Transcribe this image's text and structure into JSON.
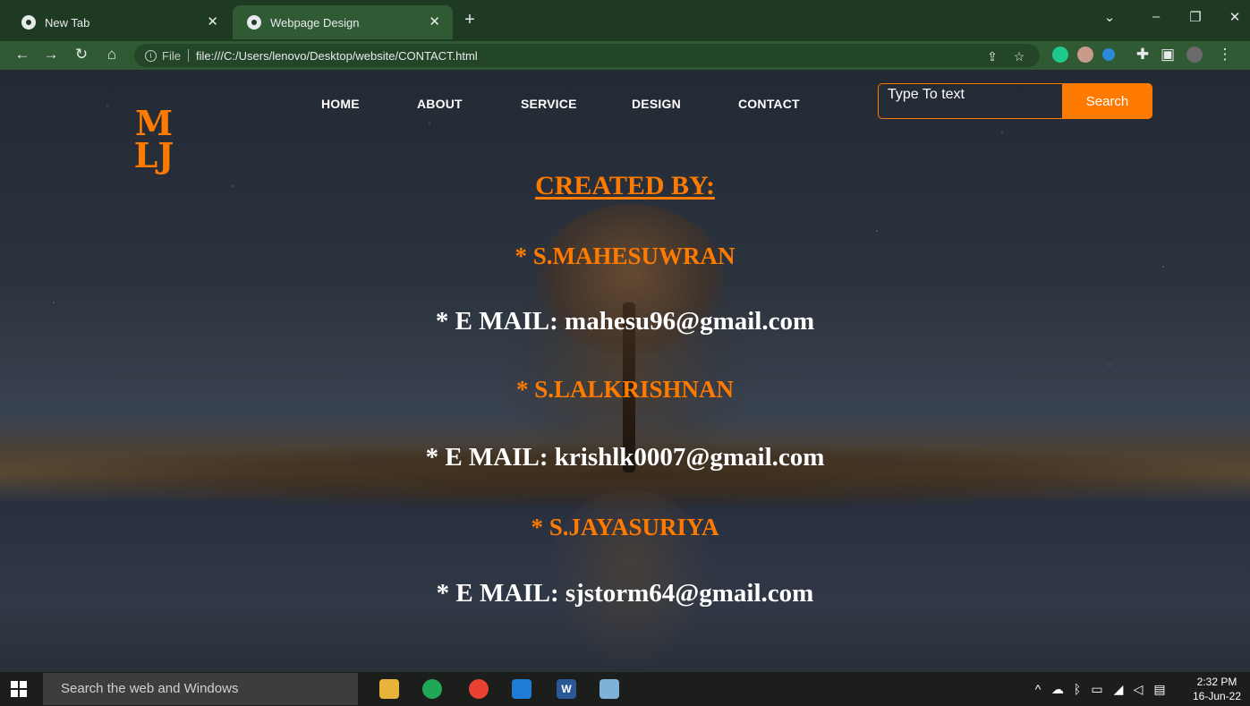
{
  "browser": {
    "tabs": [
      {
        "title": "New Tab",
        "active": false
      },
      {
        "title": "Webpage Design",
        "active": true
      }
    ],
    "new_tab_icon": "plus-icon",
    "address": {
      "scheme_label": "File",
      "url": "file:///C:/Users/lenovo/Desktop/website/CONTACT.html"
    }
  },
  "site": {
    "logo": {
      "line1": "M",
      "line2": "LJ"
    },
    "nav": [
      "HOME",
      "ABOUT",
      "SERVICE",
      "DESIGN",
      "CONTACT"
    ],
    "search": {
      "placeholder": "Type To text",
      "button_label": "Search"
    },
    "heading": "CREATED BY:",
    "contacts": [
      {
        "name": "* S.MAHESUWRAN",
        "email": "* E MAIL: mahesu96@gmail.com"
      },
      {
        "name": "* S.LALKRISHNAN",
        "email": "* E MAIL: krishlk0007@gmail.com"
      },
      {
        "name": "* S.JAYASURIYA",
        "email": "* E MAIL: sjstorm64@gmail.com"
      }
    ],
    "accent_color": "#ff7a00"
  },
  "taskbar": {
    "search_placeholder": "Search the web and Windows",
    "time": "2:32 PM",
    "date": "16-Jun-22"
  }
}
